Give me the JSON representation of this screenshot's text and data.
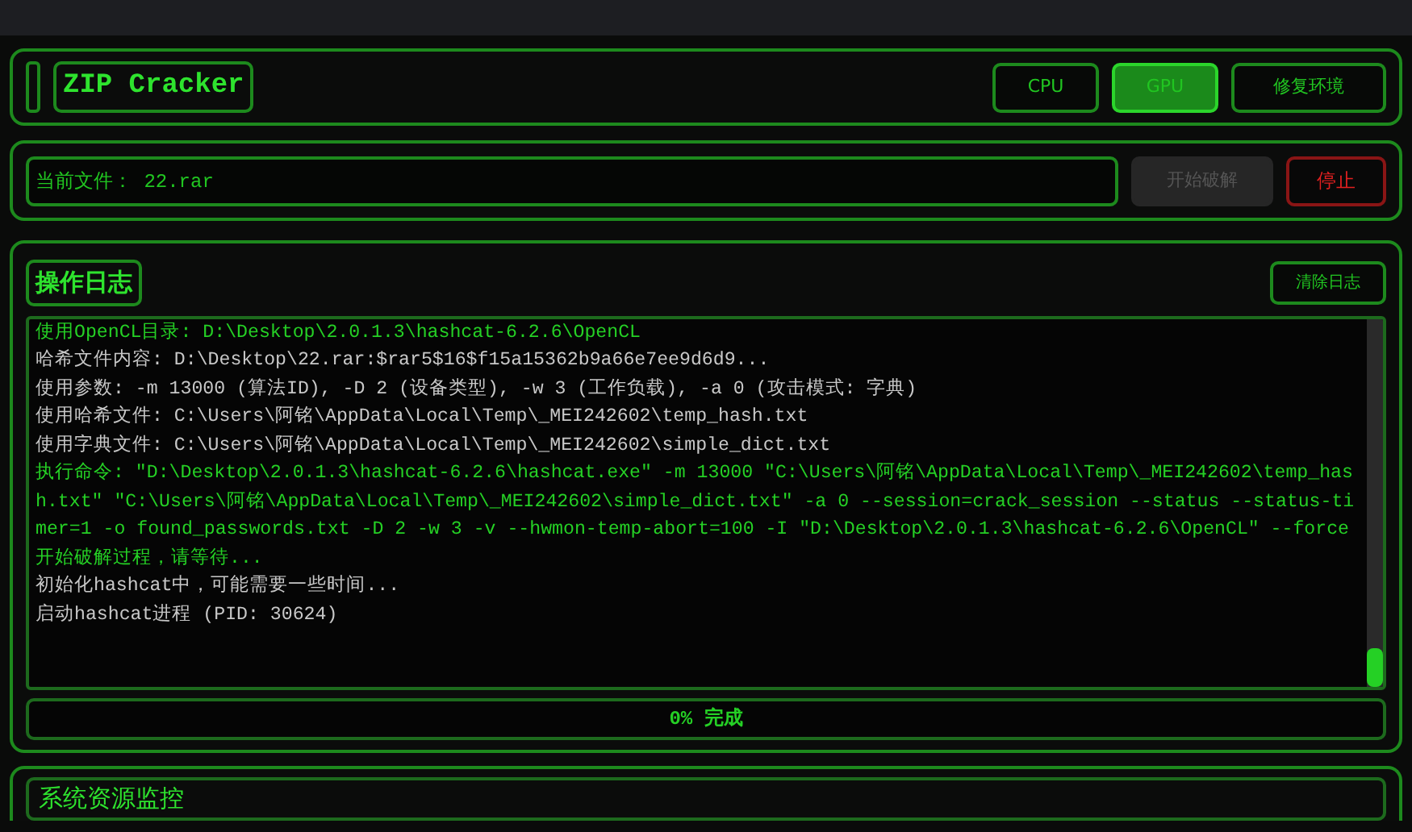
{
  "header": {
    "title": "ZIP Cracker",
    "modes": [
      {
        "label": "CPU",
        "selected": false
      },
      {
        "label": "GPU",
        "selected": true
      }
    ],
    "repair_button": "修复环境"
  },
  "file_bar": {
    "value": "当前文件： 22.rar",
    "start_button": {
      "label": "开始破解",
      "disabled": true
    },
    "stop_button": "停止"
  },
  "log": {
    "title": "操作日志",
    "clear_button": "清除日志",
    "lines": [
      {
        "kind": "info",
        "text": "使用OpenCL目录: D:\\Desktop\\2.0.1.3\\hashcat-6.2.6\\OpenCL"
      },
      {
        "kind": "plain",
        "text": "哈希文件内容: D:\\Desktop\\22.rar:$rar5$16$f15a15362b9a66e7ee9d6d9..."
      },
      {
        "kind": "plain",
        "text": "使用参数: -m 13000 (算法ID), -D 2 (设备类型), -w 3 (工作负载), -a 0 (攻击模式: 字典)"
      },
      {
        "kind": "plain",
        "text": "使用哈希文件: C:\\Users\\阿铭\\AppData\\Local\\Temp\\_MEI242602\\temp_hash.txt"
      },
      {
        "kind": "plain",
        "text": "使用字典文件: C:\\Users\\阿铭\\AppData\\Local\\Temp\\_MEI242602\\simple_dict.txt"
      },
      {
        "kind": "info",
        "text": "执行命令: \"D:\\Desktop\\2.0.1.3\\hashcat-6.2.6\\hashcat.exe\" -m 13000 \"C:\\Users\\阿铭\\AppData\\Local\\Temp\\_MEI242602\\temp_hash.txt\" \"C:\\Users\\阿铭\\AppData\\Local\\Temp\\_MEI242602\\simple_dict.txt\" -a 0 --session=crack_session --status --status-timer=1 -o found_passwords.txt -D 2 -w 3 -v --hwmon-temp-abort=100 -I \"D:\\Desktop\\2.0.1.3\\hashcat-6.2.6\\OpenCL\" --force"
      },
      {
        "kind": "info",
        "text": "开始破解过程，请等待..."
      },
      {
        "kind": "plain",
        "text": "初始化hashcat中，可能需要一些时间..."
      },
      {
        "kind": "plain",
        "text": "启动hashcat进程 (PID: 30624)"
      }
    ],
    "progress": {
      "level": 0,
      "label": "0% 完成"
    }
  },
  "monitor": {
    "title": "系统资源监控"
  }
}
